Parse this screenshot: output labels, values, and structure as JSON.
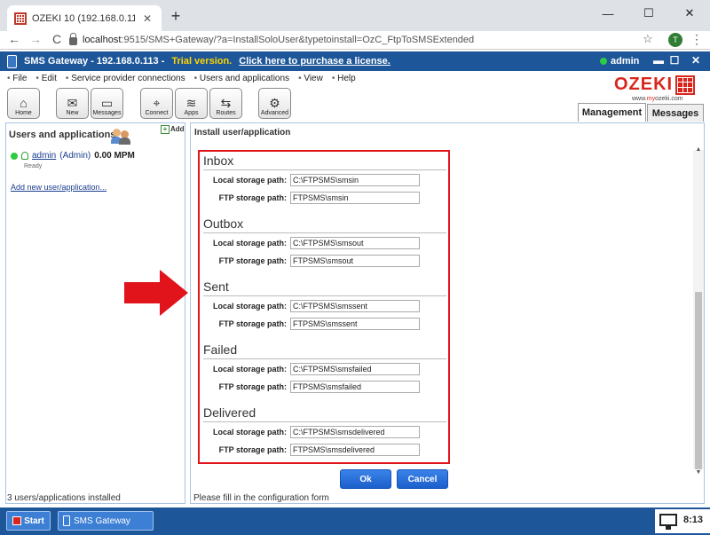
{
  "browser": {
    "tab_title": "OZEKI 10 (192.168.0.113)",
    "tab_close": "✕",
    "new_tab": "+",
    "url_host": "localhost",
    "url_rest": ":9515/SMS+Gateway/?a=InstallSoloUser&typetoinstall=OzC_FtpToSMSExtended",
    "profile_initial": "T",
    "back": "←",
    "forward": "→",
    "reload": "C",
    "star": "☆",
    "menu": "⋮",
    "win_min": "—",
    "win_max": "☐",
    "win_close": "✕"
  },
  "app": {
    "title": "SMS Gateway - 192.168.0.113 -",
    "trial": "Trial version.",
    "purchase_link": "Click here to purchase a license.",
    "user": "admin",
    "ctl_min": "▬",
    "ctl_max": "☐",
    "ctl_close": "✕"
  },
  "menu": [
    "File",
    "Edit",
    "Service provider connections",
    "Users and applications",
    "View",
    "Help"
  ],
  "toolbar": [
    {
      "label": "Home",
      "icon": "⌂"
    },
    {
      "label": "New",
      "icon": "✉"
    },
    {
      "label": "Messages",
      "icon": "▭"
    },
    {
      "label": "Connect",
      "icon": "⌖"
    },
    {
      "label": "Apps",
      "icon": "≋"
    },
    {
      "label": "Routes",
      "icon": "⇆"
    },
    {
      "label": "Advanced",
      "icon": "⚙"
    }
  ],
  "brand": {
    "name": "OZEKI",
    "site_pre": "www.",
    "site_mid": "my",
    "site_post": "ozeki.com"
  },
  "tabs": {
    "management": "Management",
    "messages": "Messages"
  },
  "left": {
    "title": "Users and applications",
    "add": "Add",
    "user_name": "admin",
    "user_role": "(Admin)",
    "user_rate": "0.00 MPM",
    "user_status": "Ready",
    "add_new": "Add new user/application...",
    "footer": "3 users/applications installed"
  },
  "main": {
    "title": "Install user/application",
    "footer": "Please fill in the configuration form",
    "ok": "Ok",
    "cancel": "Cancel",
    "local_label": "Local storage path:",
    "ftp_label": "FTP storage path:",
    "sections": [
      {
        "title": "Inbox",
        "local": "C:\\FTPSMS\\smsin",
        "ftp": "FTPSMS\\smsin"
      },
      {
        "title": "Outbox",
        "local": "C:\\FTPSMS\\smsout",
        "ftp": "FTPSMS\\smsout"
      },
      {
        "title": "Sent",
        "local": "C:\\FTPSMS\\smssent",
        "ftp": "FTPSMS\\smssent"
      },
      {
        "title": "Failed",
        "local": "C:\\FTPSMS\\smsfailed",
        "ftp": "FTPSMS\\smsfailed"
      },
      {
        "title": "Delivered",
        "local": "C:\\FTPSMS\\smsdelivered",
        "ftp": "FTPSMS\\smsdelivered"
      }
    ]
  },
  "taskbar": {
    "start": "Start",
    "task": "SMS Gateway",
    "clock": "8:13"
  },
  "colors": {
    "accent": "#1e5799",
    "highlight": "#e0141a",
    "trial": "#ffd400"
  }
}
